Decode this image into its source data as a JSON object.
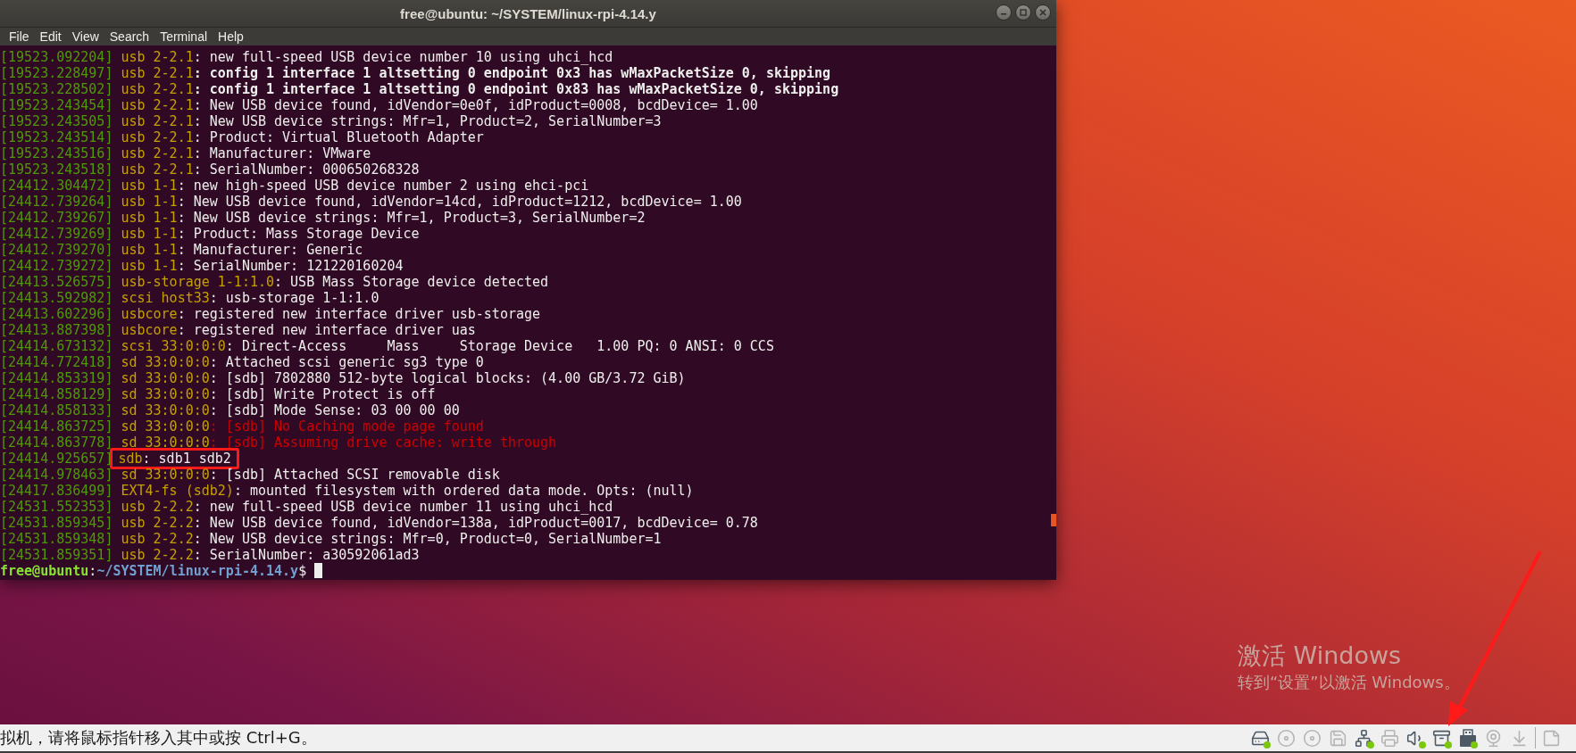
{
  "window": {
    "title": "free@ubuntu: ~/SYSTEM/linux-rpi-4.14.y"
  },
  "menu": [
    "File",
    "Edit",
    "View",
    "Search",
    "Terminal",
    "Help"
  ],
  "lines": [
    {
      "time": "[19523.092204]",
      "source": "usb 2-2.1",
      "message": ": new full-speed USB device number 10 using uhci_hcd",
      "kind": "normal",
      "highlighted": false
    },
    {
      "time": "[19523.228497]",
      "source": "usb 2-2.1",
      "message": ": config 1 interface 1 altsetting 0 endpoint 0x3 has wMaxPacketSize 0, skipping",
      "kind": "bold",
      "highlighted": false
    },
    {
      "time": "[19523.228502]",
      "source": "usb 2-2.1",
      "message": ": config 1 interface 1 altsetting 0 endpoint 0x83 has wMaxPacketSize 0, skipping",
      "kind": "bold",
      "highlighted": false
    },
    {
      "time": "[19523.243454]",
      "source": "usb 2-2.1",
      "message": ": New USB device found, idVendor=0e0f, idProduct=0008, bcdDevice= 1.00",
      "kind": "normal",
      "highlighted": false
    },
    {
      "time": "[19523.243505]",
      "source": "usb 2-2.1",
      "message": ": New USB device strings: Mfr=1, Product=2, SerialNumber=3",
      "kind": "normal",
      "highlighted": false
    },
    {
      "time": "[19523.243514]",
      "source": "usb 2-2.1",
      "message": ": Product: Virtual Bluetooth Adapter",
      "kind": "normal",
      "highlighted": false
    },
    {
      "time": "[19523.243516]",
      "source": "usb 2-2.1",
      "message": ": Manufacturer: VMware",
      "kind": "normal",
      "highlighted": false
    },
    {
      "time": "[19523.243518]",
      "source": "usb 2-2.1",
      "message": ": SerialNumber: 000650268328",
      "kind": "normal",
      "highlighted": false
    },
    {
      "time": "[24412.304472]",
      "source": "usb 1-1",
      "message": ": new high-speed USB device number 2 using ehci-pci",
      "kind": "normal",
      "highlighted": false
    },
    {
      "time": "[24412.739264]",
      "source": "usb 1-1",
      "message": ": New USB device found, idVendor=14cd, idProduct=1212, bcdDevice= 1.00",
      "kind": "normal",
      "highlighted": false
    },
    {
      "time": "[24412.739267]",
      "source": "usb 1-1",
      "message": ": New USB device strings: Mfr=1, Product=3, SerialNumber=2",
      "kind": "normal",
      "highlighted": false
    },
    {
      "time": "[24412.739269]",
      "source": "usb 1-1",
      "message": ": Product: Mass Storage Device",
      "kind": "normal",
      "highlighted": false
    },
    {
      "time": "[24412.739270]",
      "source": "usb 1-1",
      "message": ": Manufacturer: Generic",
      "kind": "normal",
      "highlighted": false
    },
    {
      "time": "[24412.739272]",
      "source": "usb 1-1",
      "message": ": SerialNumber: 121220160204",
      "kind": "normal",
      "highlighted": false
    },
    {
      "time": "[24413.526575]",
      "source": "usb-storage 1-1:1.0",
      "message": ": USB Mass Storage device detected",
      "kind": "normal",
      "highlighted": false
    },
    {
      "time": "[24413.592982]",
      "source": "scsi host33",
      "message": ": usb-storage 1-1:1.0",
      "kind": "normal",
      "highlighted": false
    },
    {
      "time": "[24413.602296]",
      "source": "usbcore",
      "message": ": registered new interface driver usb-storage",
      "kind": "normal",
      "highlighted": false
    },
    {
      "time": "[24413.887398]",
      "source": "usbcore",
      "message": ": registered new interface driver uas",
      "kind": "normal",
      "highlighted": false
    },
    {
      "time": "[24414.673132]",
      "source": "scsi 33:0:0:0",
      "message": ": Direct-Access     Mass     Storage Device   1.00 PQ: 0 ANSI: 0 CCS",
      "kind": "normal",
      "highlighted": false
    },
    {
      "time": "[24414.772418]",
      "source": "sd 33:0:0:0",
      "message": ": Attached scsi generic sg3 type 0",
      "kind": "normal",
      "highlighted": false
    },
    {
      "time": "[24414.853319]",
      "source": "sd 33:0:0:0",
      "message": ": [sdb] 7802880 512-byte logical blocks: (4.00 GB/3.72 GiB)",
      "kind": "normal",
      "highlighted": false
    },
    {
      "time": "[24414.858129]",
      "source": "sd 33:0:0:0",
      "message": ": [sdb] Write Protect is off",
      "kind": "normal",
      "highlighted": false
    },
    {
      "time": "[24414.858133]",
      "source": "sd 33:0:0:0",
      "message": ": [sdb] Mode Sense: 03 00 00 00",
      "kind": "normal",
      "highlighted": false
    },
    {
      "time": "[24414.863725]",
      "source": "sd 33:0:0:0",
      "message": ": [sdb] No Caching mode page found",
      "kind": "error",
      "highlighted": false
    },
    {
      "time": "[24414.863778]",
      "source": "sd 33:0:0:0",
      "message": ": [sdb] Assuming drive cache: write through",
      "kind": "error",
      "highlighted": false
    },
    {
      "time": "[24414.925657]",
      "source": "sdb",
      "message": ": sdb1 sdb2",
      "kind": "normal",
      "highlighted": true
    },
    {
      "time": "[24414.978463]",
      "source": "sd 33:0:0:0",
      "message": ": [sdb] Attached SCSI removable disk",
      "kind": "normal",
      "highlighted": false
    },
    {
      "time": "[24417.836499]",
      "source": "EXT4-fs (sdb2)",
      "message": ": mounted filesystem with ordered data mode. Opts: (null)",
      "kind": "normal",
      "highlighted": false
    },
    {
      "time": "[24531.552353]",
      "source": "usb 2-2.2",
      "message": ": new full-speed USB device number 11 using uhci_hcd",
      "kind": "normal",
      "highlighted": false
    },
    {
      "time": "[24531.859345]",
      "source": "usb 2-2.2",
      "message": ": New USB device found, idVendor=138a, idProduct=0017, bcdDevice= 0.78",
      "kind": "normal",
      "highlighted": false
    },
    {
      "time": "[24531.859348]",
      "source": "usb 2-2.2",
      "message": ": New USB device strings: Mfr=0, Product=0, SerialNumber=1",
      "kind": "normal",
      "highlighted": false
    },
    {
      "time": "[24531.859351]",
      "source": "usb 2-2.2",
      "message": ": SerialNumber: a30592061ad3",
      "kind": "normal",
      "highlighted": false
    }
  ],
  "prompt": {
    "user_host": "free@ubuntu",
    "separator": ":",
    "path": "~/SYSTEM/linux-rpi-4.14.y",
    "symbol": "$"
  },
  "activation_notice": {
    "title": "激活 Windows",
    "subtitle": "转到“设置”以激活 Windows。"
  },
  "status_bar": {
    "message": "拟机，请将鼠标指针移入其中或按 Ctrl+G。",
    "devices": [
      {
        "kind": "disk",
        "connected": true
      },
      {
        "kind": "disc",
        "connected": false
      },
      {
        "kind": "disc",
        "connected": false
      },
      {
        "kind": "floppy",
        "connected": false
      },
      {
        "kind": "network",
        "connected": true
      },
      {
        "kind": "printer",
        "connected": false
      },
      {
        "kind": "sound",
        "connected": true
      },
      {
        "kind": "archive",
        "connected": true
      },
      {
        "kind": "usb",
        "connected": true
      },
      {
        "kind": "webcam",
        "connected": false
      },
      {
        "kind": "download",
        "connected": false
      },
      {
        "kind": "note",
        "connected": false
      }
    ]
  }
}
